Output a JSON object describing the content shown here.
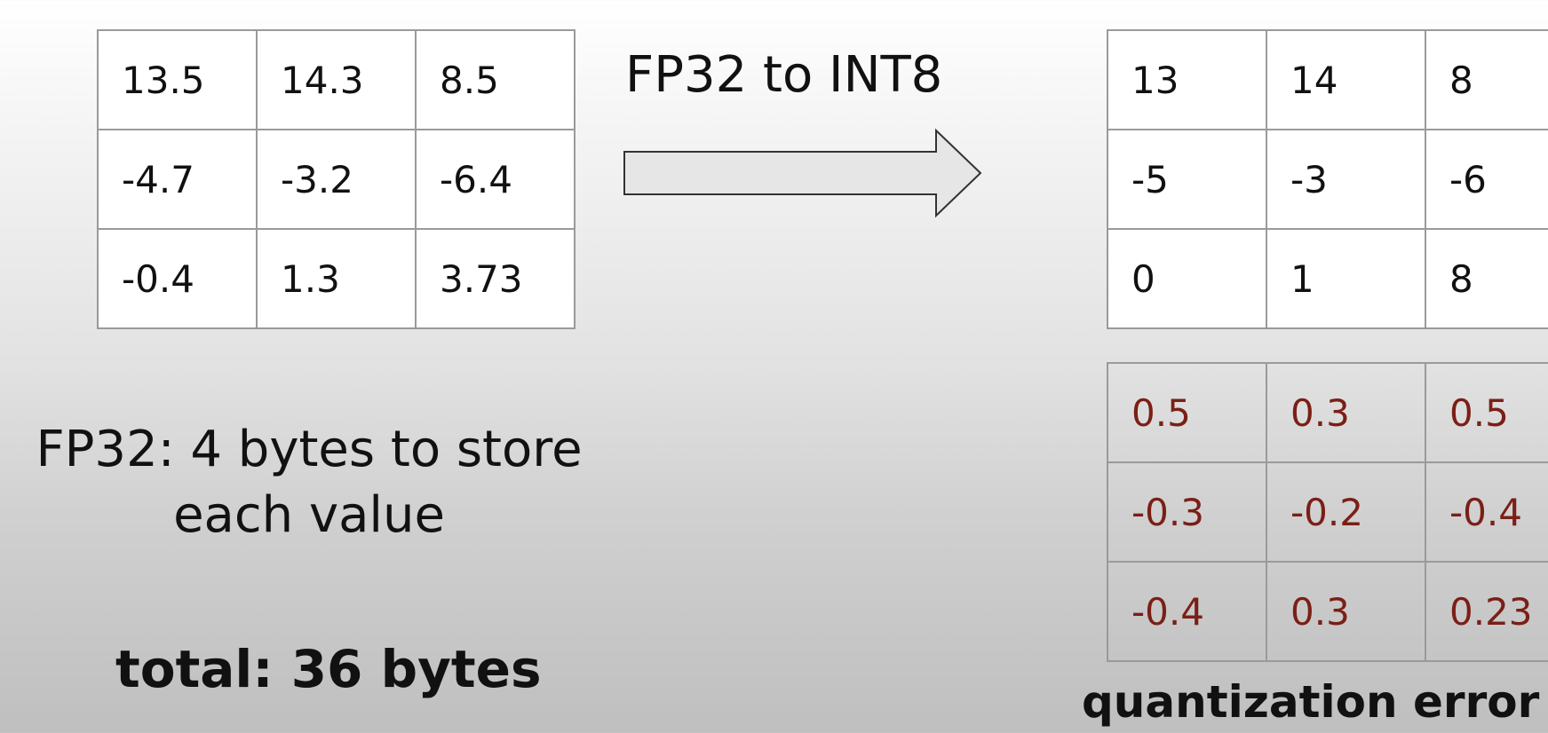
{
  "source_matrix": {
    "rows": [
      [
        "13.5",
        "14.3",
        "8.5"
      ],
      [
        "-4.7",
        "-3.2",
        "-6.4"
      ],
      [
        "-0.4",
        "1.3",
        "3.73"
      ]
    ]
  },
  "conversion": {
    "label": "FP32 to INT8"
  },
  "quantized_matrix": {
    "rows": [
      [
        "13",
        "14",
        "8"
      ],
      [
        "-5",
        "-3",
        "-6"
      ],
      [
        "0",
        "1",
        "8"
      ]
    ]
  },
  "error_matrix": {
    "rows": [
      [
        "0.5",
        "0.3",
        "0.5"
      ],
      [
        "-0.3",
        "-0.2",
        "-0.4"
      ],
      [
        "-0.4",
        "0.3",
        "0.23"
      ]
    ],
    "caption": "quantization error"
  },
  "storage": {
    "line1": "FP32: 4 bytes to store",
    "line2": "each value",
    "total": "total: 36 bytes"
  },
  "colors": {
    "error_text": "#7a1f17",
    "arrow_fill": "#e6e6e6",
    "arrow_stroke": "#333333"
  }
}
